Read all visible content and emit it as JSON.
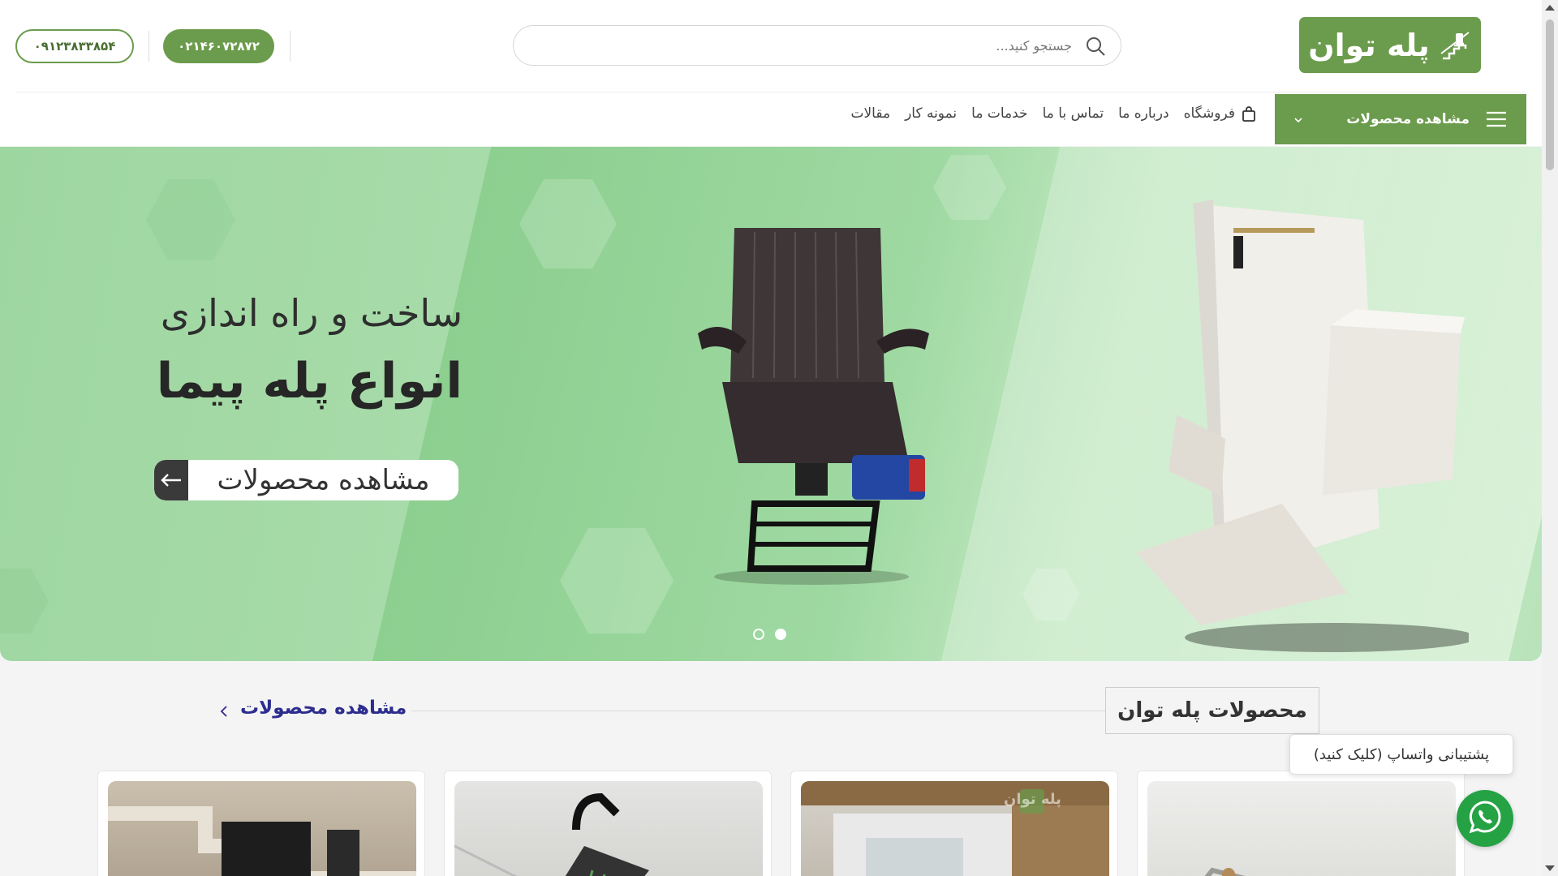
{
  "header": {
    "logo_text": "پله توان",
    "search_placeholder": "جستجو کنید...",
    "phone_primary": "۰۲۱۴۶۰۷۲۸۷۲",
    "phone_secondary": "۰۹۱۲۳۸۳۳۸۵۴"
  },
  "nav": {
    "products_menu_label": "مشاهده محصولات",
    "items": [
      {
        "label": "فروشگاه"
      },
      {
        "label": "درباره ما"
      },
      {
        "label": "تماس با ما"
      },
      {
        "label": "خدمات ما"
      },
      {
        "label": "نمونه کار"
      },
      {
        "label": "مقالات"
      }
    ]
  },
  "hero": {
    "title_line1": "ساخت و راه اندازی",
    "title_line2": "انواع پله پیما",
    "button_label": "مشاهده محصولات",
    "slide_count": 2,
    "active_slide": 2
  },
  "products_section": {
    "title": "محصولات پله توان",
    "view_all_label": "مشاهده محصولات",
    "card_watermark": "پله توان"
  },
  "whatsapp": {
    "tooltip": "پشتیبانی واتساپ (کلیک کنید)"
  },
  "colors": {
    "brand_green": "#6b9b4c",
    "link_blue": "#2d2d8f",
    "whatsapp_green": "#25a244"
  }
}
